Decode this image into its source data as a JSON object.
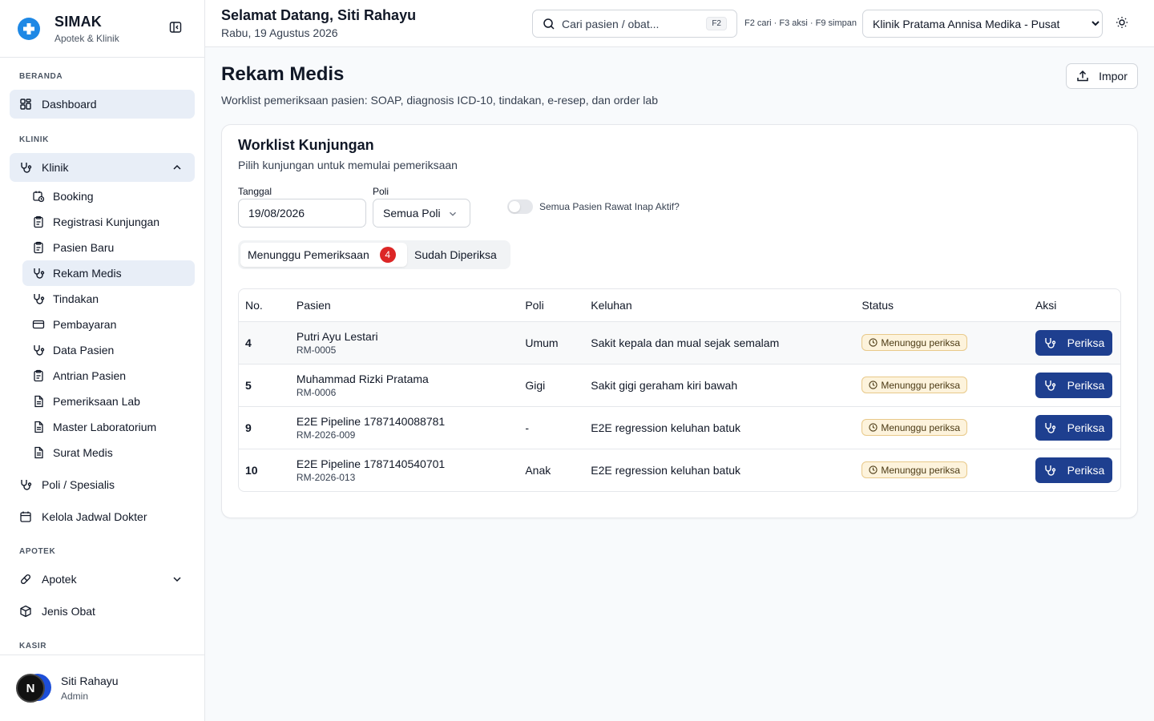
{
  "brand": {
    "title": "SIMAK",
    "subtitle": "Apotek & Klinik"
  },
  "sidebar": {
    "sections": {
      "beranda": "BERANDA",
      "klinik": "KLINIK",
      "apotek": "APOTEK",
      "kasir": "KASIR"
    },
    "dashboard": "Dashboard",
    "klinik_group": "Klinik",
    "klinik_items": [
      "Booking",
      "Registrasi Kunjungan",
      "Pasien Baru",
      "Rekam Medis",
      "Tindakan",
      "Pembayaran",
      "Data Pasien",
      "Antrian Pasien",
      "Pemeriksaan Lab",
      "Master Laboratorium",
      "Surat Medis"
    ],
    "poli": "Poli / Spesialis",
    "jadwal": "Kelola Jadwal Dokter",
    "apotek_group": "Apotek",
    "jenis_obat": "Jenis Obat"
  },
  "user": {
    "initial": "N",
    "name": "Siti Rahayu",
    "role": "Admin"
  },
  "header": {
    "greeting": "Selamat Datang, Siti Rahayu",
    "date": "Rabu, 19 Agustus 2026",
    "search_placeholder": "Cari pasien / obat...",
    "search_kbd": "F2",
    "shortcuts": "F2 cari · F3 aksi · F9 simpan",
    "clinic": "Klinik Pratama Annisa Medika - Pusat"
  },
  "page": {
    "title": "Rekam Medis",
    "subtitle": "Worklist pemeriksaan pasien: SOAP, diagnosis ICD-10, tindakan, e-resep, dan order lab",
    "import_label": "Impor"
  },
  "worklist": {
    "title": "Worklist Kunjungan",
    "subtitle": "Pilih kunjungan untuk memulai pemeriksaan",
    "tanggal_label": "Tanggal",
    "tanggal_value": "19/08/2026",
    "poli_label": "Poli",
    "poli_value": "Semua Poli",
    "toggle_label": "Semua Pasien Rawat Inap Aktif?",
    "tab_waiting": "Menunggu Pemeriksaan",
    "tab_waiting_count": "4",
    "tab_done": "Sudah Diperiksa",
    "columns": {
      "no": "No.",
      "pasien": "Pasien",
      "poli": "Poli",
      "keluhan": "Keluhan",
      "status": "Status",
      "aksi": "Aksi"
    },
    "rows": [
      {
        "no": "4",
        "name": "Putri Ayu Lestari",
        "rm": "RM-0005",
        "poli": "Umum",
        "keluhan": "Sakit kepala dan mual sejak semalam",
        "status": "Menunggu periksa",
        "action": "Periksa"
      },
      {
        "no": "5",
        "name": "Muhammad Rizki Pratama",
        "rm": "RM-0006",
        "poli": "Gigi",
        "keluhan": "Sakit gigi geraham kiri bawah",
        "status": "Menunggu periksa",
        "action": "Periksa"
      },
      {
        "no": "9",
        "name": "E2E Pipeline 1787140088781",
        "rm": "RM-2026-009",
        "poli": "-",
        "keluhan": "E2E regression keluhan batuk",
        "status": "Menunggu periksa",
        "action": "Periksa"
      },
      {
        "no": "10",
        "name": "E2E Pipeline 1787140540701",
        "rm": "RM-2026-013",
        "poli": "Anak",
        "keluhan": "E2E regression keluhan batuk",
        "status": "Menunggu periksa",
        "action": "Periksa"
      }
    ]
  },
  "icons": {
    "brand": "medical-cross-icon",
    "collapse": "sidebar-collapse-icon",
    "dashboard": "grid-icon",
    "klinik": "stethoscope-icon",
    "search": "search-icon",
    "theme": "sun-icon",
    "import": "upload-icon",
    "status": "clock-icon"
  },
  "colors": {
    "primary": "#1e3f8f",
    "brand": "#1e88e5",
    "badge": "#dc2626",
    "status_bg": "#fdf3dc"
  }
}
